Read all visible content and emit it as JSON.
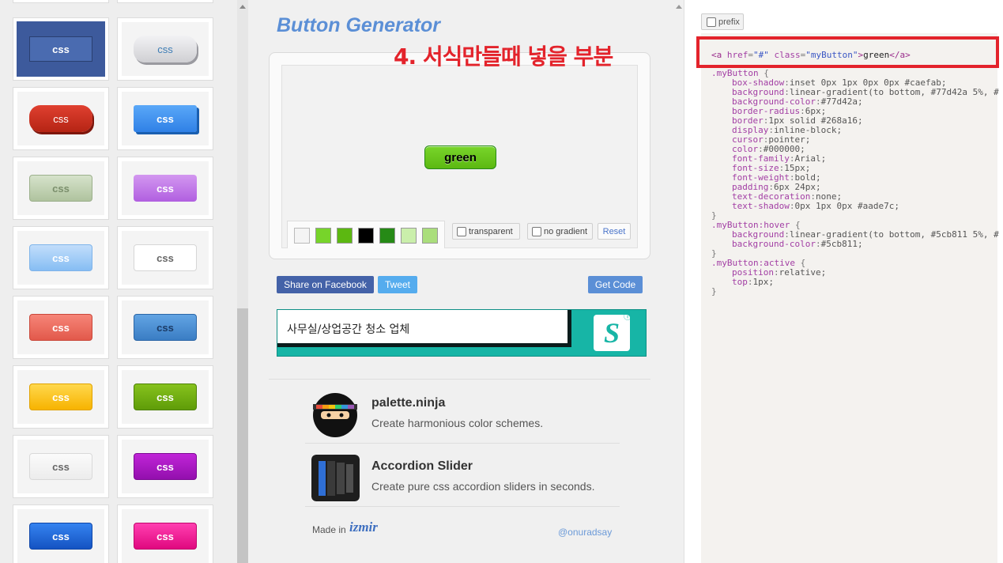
{
  "gallery": {
    "tiles": [
      {
        "label": "css",
        "bg": "#3d5a9c",
        "color": "#ffffff",
        "style": "square"
      },
      {
        "label": "css",
        "bg": "#dcdcde",
        "color": "#3e7db5",
        "style": "pill-grey"
      },
      {
        "label": "css",
        "bg": "#c62d1f",
        "color": "#ffffff",
        "style": "pill-red"
      },
      {
        "label": "css",
        "bg": "#3d94f6",
        "color": "#ffffff",
        "style": "blue-3d"
      },
      {
        "label": "css",
        "bg": "#c5d6b8",
        "color": "#7b8f6c",
        "style": "sage"
      },
      {
        "label": "css",
        "bg": "#c57ee8",
        "color": "#ffffff",
        "style": "violet"
      },
      {
        "label": "css",
        "bg": "#a4cdf7",
        "color": "#ffffff",
        "style": "lightblue"
      },
      {
        "label": "css",
        "bg": "#ffffff",
        "color": "#666666",
        "style": "white"
      },
      {
        "label": "css",
        "bg": "#f07468",
        "color": "#ffffff",
        "style": "salmon"
      },
      {
        "label": "css",
        "bg": "#4a8fd4",
        "color": "#1b3b66",
        "style": "blue-dark"
      },
      {
        "label": "css",
        "bg": "#ffc51f",
        "color": "#ffffff",
        "style": "yellow"
      },
      {
        "label": "css",
        "bg": "#6fae12",
        "color": "#ffffff",
        "style": "olive"
      },
      {
        "label": "css",
        "bg": "#f6f6f6",
        "color": "#666666",
        "style": "lightgrey"
      },
      {
        "label": "css",
        "bg": "#b018c9",
        "color": "#ffffff",
        "style": "purple"
      },
      {
        "label": "css",
        "bg": "#2168d8",
        "color": "#ffffff",
        "style": "royal"
      },
      {
        "label": "css",
        "bg": "#f21b98",
        "color": "#ffffff",
        "style": "pink"
      }
    ]
  },
  "generator": {
    "title": "Button Generator",
    "preview_button_label": "green",
    "swatches": [
      "#f4f4f4",
      "#77d42a",
      "#5cb811",
      "#000000",
      "#268a16",
      "#caefab",
      "#aade7c"
    ],
    "transparent_label": "transparent",
    "no_gradient_label": "no gradient",
    "reset_label": "Reset"
  },
  "actions": {
    "facebook_label": "Share on Facebook",
    "tweet_label": "Tweet",
    "get_code_label": "Get Code"
  },
  "ad": {
    "text": "사무실/상업공간 청소 업체",
    "logo_glyph": "S",
    "info_glyph": "ⓘ",
    "close_glyph": "✕"
  },
  "promos": [
    {
      "title": "palette.ninja",
      "desc": "Create harmonious color schemes."
    },
    {
      "title": "Accordion Slider",
      "desc": "Create pure css accordion sliders in seconds."
    }
  ],
  "footer": {
    "made_in": "Made in",
    "logo": "izmir",
    "author": "@onuradsay"
  },
  "code_panel": {
    "prefix_label": "prefix",
    "annotation": "4. 서식만들때 넣을 부분",
    "html_tag_open": "<a",
    "html_attr1": "href",
    "html_val1": "\"#\"",
    "html_attr2": "class",
    "html_val2": "\"myButton\"",
    "html_close": ">",
    "html_text": "green",
    "html_end": "</a>",
    "css": [
      {
        "type": "sel",
        "text": ".myButton {"
      },
      {
        "type": "decl",
        "prop": "box-shadow",
        "val": "inset 0px 1px 0px 0px #caefab;"
      },
      {
        "type": "decl",
        "prop": "background",
        "val": "linear-gradient(to bottom, #77d42a 5%, #"
      },
      {
        "type": "decl",
        "prop": "background-color",
        "val": "#77d42a;"
      },
      {
        "type": "decl",
        "prop": "border-radius",
        "val": "6px;"
      },
      {
        "type": "decl",
        "prop": "border",
        "val": "1px solid #268a16;"
      },
      {
        "type": "decl",
        "prop": "display",
        "val": "inline-block;"
      },
      {
        "type": "decl",
        "prop": "cursor",
        "val": "pointer;"
      },
      {
        "type": "decl",
        "prop": "color",
        "val": "#000000;"
      },
      {
        "type": "decl",
        "prop": "font-family",
        "val": "Arial;"
      },
      {
        "type": "decl",
        "prop": "font-size",
        "val": "15px;"
      },
      {
        "type": "decl",
        "prop": "font-weight",
        "val": "bold;"
      },
      {
        "type": "decl",
        "prop": "padding",
        "val": "6px 24px;"
      },
      {
        "type": "decl",
        "prop": "text-decoration",
        "val": "none;"
      },
      {
        "type": "decl",
        "prop": "text-shadow",
        "val": "0px 1px 0px #aade7c;"
      },
      {
        "type": "end",
        "text": "}"
      },
      {
        "type": "sel",
        "text": ".myButton:hover {"
      },
      {
        "type": "decl",
        "prop": "background",
        "val": "linear-gradient(to bottom, #5cb811 5%, #"
      },
      {
        "type": "decl",
        "prop": "background-color",
        "val": "#5cb811;"
      },
      {
        "type": "end",
        "text": "}"
      },
      {
        "type": "sel",
        "text": ".myButton:active {"
      },
      {
        "type": "decl",
        "prop": "position",
        "val": "relative;"
      },
      {
        "type": "decl",
        "prop": "top",
        "val": "1px;"
      },
      {
        "type": "end",
        "text": "}"
      }
    ]
  }
}
